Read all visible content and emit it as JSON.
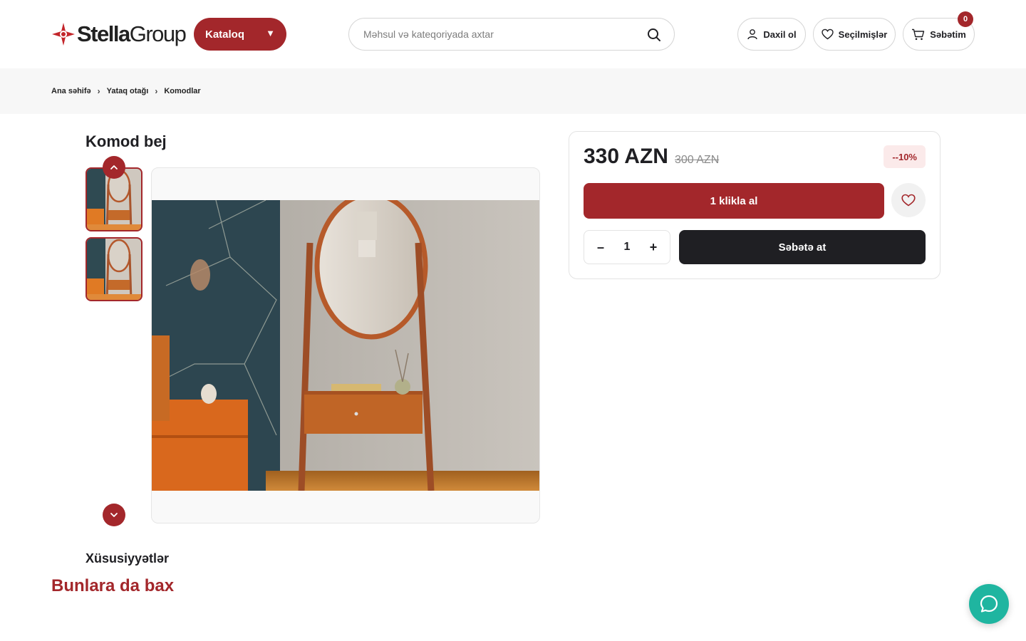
{
  "header": {
    "logo": {
      "brand_bold": "Stella",
      "brand_light": "Group"
    },
    "catalog_label": "Kataloq",
    "search": {
      "placeholder": "Məhsul və kateqoriyada axtar",
      "value": ""
    },
    "login_label": "Daxil ol",
    "favorites_label": "Seçilmişlər",
    "cart_label": "Səbətim",
    "cart_count": "0"
  },
  "breadcrumb": [
    "Ana səhifə",
    "Yataq otağı",
    "Komodlar"
  ],
  "product": {
    "title": "Komod bej",
    "price": "330 AZN",
    "old_price": "300 AZN",
    "discount": "--10%",
    "buy_one_click": "1 klikla al",
    "quantity": "1",
    "qty_minus": "–",
    "qty_plus": "+",
    "add_to_cart": "Səbətə at"
  },
  "sections": {
    "characteristics": "Xüsusiyyətlər",
    "see_also": "Bunlara da bax"
  },
  "icons": {
    "search": "search-icon",
    "user": "user-icon",
    "heart": "heart-icon",
    "cart": "cart-icon",
    "chevron_up": "chevron-up-icon",
    "chevron_down": "chevron-down-icon",
    "chat": "chat-icon",
    "dropdown": "triangle-down-icon"
  },
  "colors": {
    "brand": "#a3272b",
    "dark": "#1f1f23",
    "chat": "#1fb5a0"
  }
}
